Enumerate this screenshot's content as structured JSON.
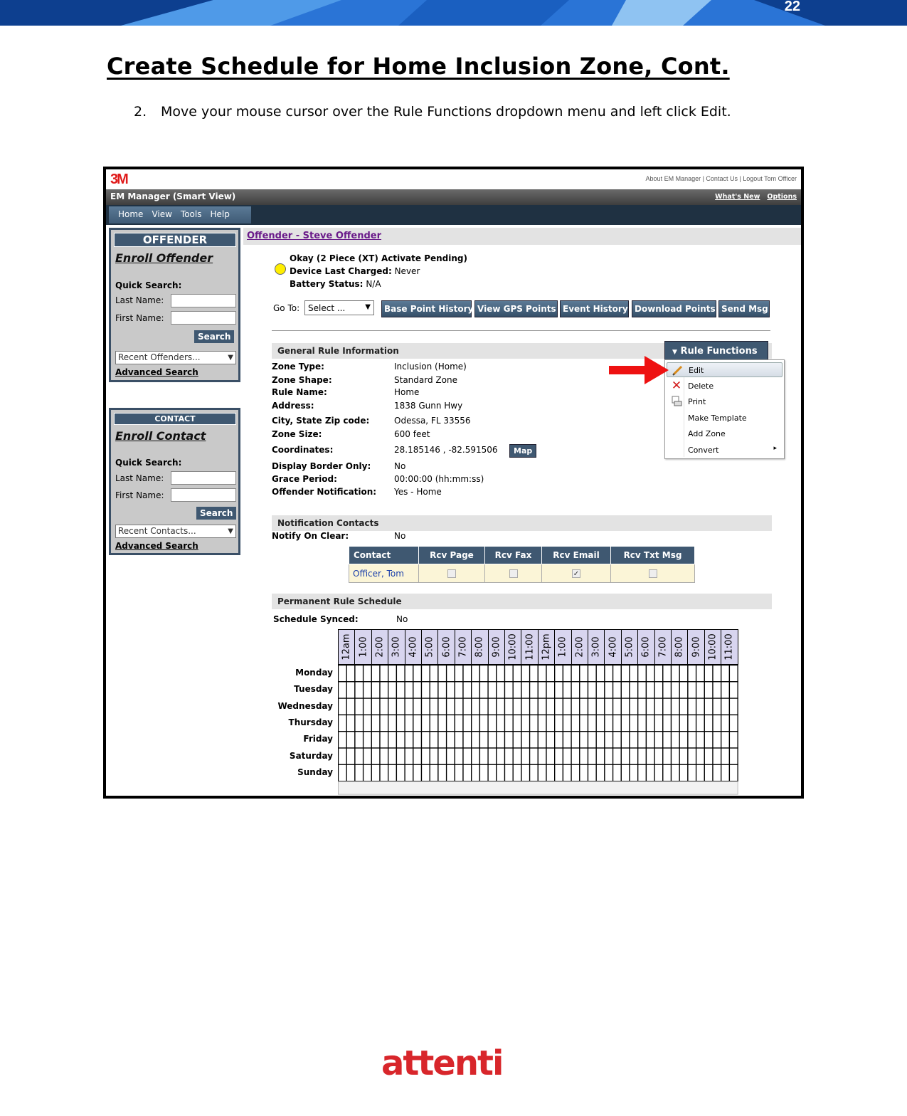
{
  "page": {
    "number": "22",
    "title": "Create Schedule for Home Inclusion Zone, Cont.",
    "step_number": "2.",
    "step_text": "Move your mouse cursor over the Rule Functions dropdown menu and left click Edit."
  },
  "app": {
    "logo": "3M",
    "top_links": "About EM Manager | Contact Us | Logout Tom Officer",
    "title": "EM Manager (Smart View)",
    "whats_new": "What's New",
    "options": "Options",
    "nav": [
      "Home",
      "View",
      "Tools",
      "Help"
    ]
  },
  "offender_panel": {
    "header": "OFFENDER",
    "enroll": "Enroll Offender",
    "quick_search": "Quick Search:",
    "last_name": "Last Name:",
    "first_name": "First Name:",
    "search": "Search",
    "recent": "Recent Offenders...",
    "advanced": "Advanced Search"
  },
  "contact_panel": {
    "header": "CONTACT",
    "enroll": "Enroll Contact",
    "quick_search": "Quick Search:",
    "last_name": "Last Name:",
    "first_name": "First Name:",
    "search": "Search",
    "recent": "Recent Contacts...",
    "advanced": "Advanced Search"
  },
  "offender": {
    "breadcrumb": "Offender - Steve Offender",
    "device": "Okay (2 Piece (XT) Activate Pending)",
    "charged_label": "Device Last Charged:",
    "charged_value": "Never",
    "battery_label": "Battery Status:",
    "battery_value": "N/A",
    "goto_label": "Go To:",
    "goto_value": "Select ...",
    "actions": [
      "Base Point History",
      "View GPS Points",
      "Event History",
      "Download Points",
      "Send Msg"
    ]
  },
  "general": {
    "header": "General Rule Information",
    "rows": [
      {
        "k": "Zone Type:",
        "v": "Inclusion (Home)"
      },
      {
        "k": "Zone Shape:",
        "v": "Standard Zone"
      },
      {
        "k": "Rule Name:",
        "v": "Home"
      },
      {
        "k": "Address:",
        "v": "1838 Gunn Hwy"
      },
      {
        "k": "City, State Zip code:",
        "v": "Odessa, FL 33556"
      },
      {
        "k": "Zone Size:",
        "v": "600 feet"
      },
      {
        "k": "Coordinates:",
        "v": "28.185146 , -82.591506"
      },
      {
        "k": "Display Border Only:",
        "v": "No"
      },
      {
        "k": "Grace Period:",
        "v": "00:00:00    (hh:mm:ss)"
      },
      {
        "k": "Offender Notification:",
        "v": "Yes - Home"
      }
    ],
    "map": "Map"
  },
  "rule_functions": {
    "label": "Rule Functions",
    "items": [
      "Edit",
      "Delete",
      "Print",
      "Make Template",
      "Add Zone",
      "Convert"
    ]
  },
  "notification": {
    "header": "Notification Contacts",
    "notify_label": "Notify On Clear:",
    "notify_value": "No",
    "columns": [
      "Contact",
      "Rcv Page",
      "Rcv Fax",
      "Rcv Email",
      "Rcv Txt Msg"
    ],
    "row": {
      "contact": "Officer, Tom",
      "checks": [
        false,
        false,
        true,
        false
      ]
    }
  },
  "schedule": {
    "header": "Permanent Rule Schedule",
    "synced_label": "Schedule Synced:",
    "synced_value": "No",
    "hours": [
      "12am",
      "1:00",
      "2:00",
      "3:00",
      "4:00",
      "5:00",
      "6:00",
      "7:00",
      "8:00",
      "9:00",
      "10:00",
      "11:00",
      "12pm",
      "1:00",
      "2:00",
      "3:00",
      "4:00",
      "5:00",
      "6:00",
      "7:00",
      "8:00",
      "9:00",
      "10:00",
      "11:00"
    ],
    "days": [
      "Monday",
      "Tuesday",
      "Wednesday",
      "Thursday",
      "Friday",
      "Saturday",
      "Sunday"
    ]
  },
  "footer_logo": "attenti",
  "colors": {
    "accent_blue": "#3f5871",
    "banner_blue": "#1b63c4",
    "logo_red": "#e01b1b",
    "arrow_red": "#ee1111"
  }
}
